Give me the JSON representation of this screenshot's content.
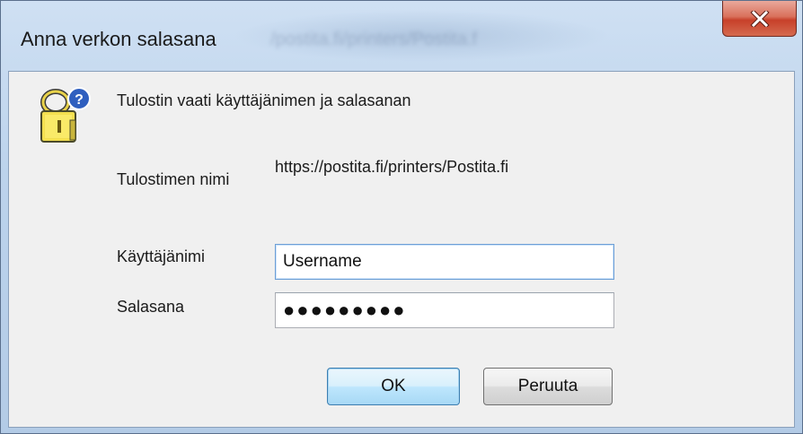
{
  "window": {
    "title": "Anna verkon salasana",
    "background_hint": "/postita.fi/printers/Postita.f"
  },
  "dialog": {
    "prompt": "Tulostin vaati käyttäjänimen ja salasanan",
    "printer_name_label": "Tulostimen nimi",
    "printer_name_value": "https://postita.fi/printers/Postita.fi",
    "username_label": "Käyttäjänimi",
    "username_value": "Username",
    "password_label": "Salasana",
    "password_value": "●●●●●●●●●"
  },
  "buttons": {
    "ok": "OK",
    "cancel": "Peruuta"
  },
  "icons": {
    "close": "close-icon",
    "keys": "keys-help-icon"
  },
  "colors": {
    "close_red": "#c7402a",
    "frame_blue": "#bcd3ec",
    "client_bg": "#f0f0f0",
    "default_button_blue": "#3c7fb1"
  }
}
